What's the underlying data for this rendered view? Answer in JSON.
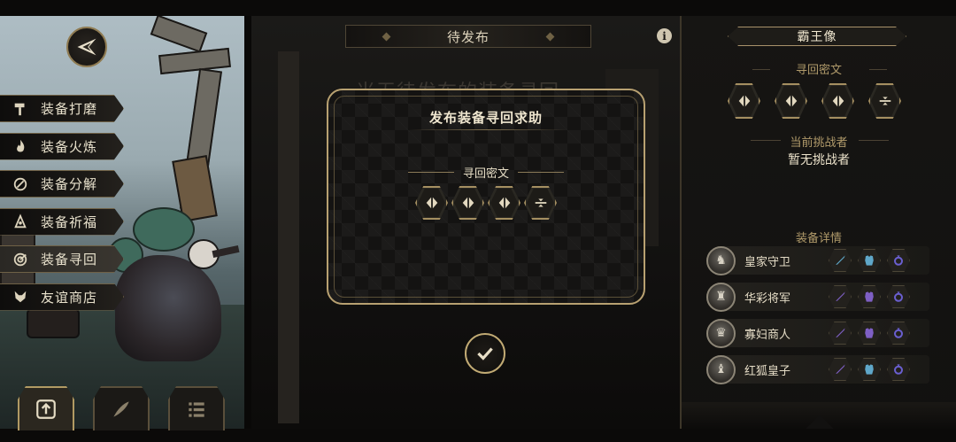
{
  "menu": {
    "items": [
      {
        "label": "装备打磨",
        "icon": "hammer-icon"
      },
      {
        "label": "装备火炼",
        "icon": "flame-icon"
      },
      {
        "label": "装备分解",
        "icon": "disassemble-icon"
      },
      {
        "label": "装备祈福",
        "icon": "blessing-icon"
      },
      {
        "label": "装备寻回",
        "icon": "retrieve-icon"
      },
      {
        "label": "友谊商店",
        "icon": "fox-shop-icon"
      }
    ],
    "active_index": 4
  },
  "bottom_tabs": [
    {
      "icon": "upload-arrow-icon",
      "active": true
    },
    {
      "icon": "feather-icon",
      "active": false
    },
    {
      "icon": "list-icon",
      "active": false
    }
  ],
  "center": {
    "pending_title": "待发布",
    "background_text": "当无待发布的装备寻回"
  },
  "dialog": {
    "title": "发布装备寻回求助",
    "rune_label": "寻回密文",
    "runes": [
      "split-diamond-rune-icon",
      "split-diamond-rune-icon",
      "split-diamond-rune-icon",
      "bar-rune-icon"
    ]
  },
  "statue": {
    "title": "霸王像",
    "rune_label": "寻回密文",
    "runes": [
      "split-diamond-rune-icon",
      "split-diamond-rune-icon",
      "split-diamond-rune-icon",
      "bar-rune-icon"
    ],
    "challenger_label": "当前挑战者",
    "challenger_value": "暂无挑战者",
    "equip_label": "装备详情",
    "equipment": [
      {
        "name": "皇家守卫",
        "avatar": "guard-avatar",
        "slots": [
          "sword-icon",
          "armor-icon",
          "ring-icon"
        ]
      },
      {
        "name": "华彩将军",
        "avatar": "general-avatar",
        "slots": [
          "sword-icon",
          "armor-icon",
          "ring-icon"
        ]
      },
      {
        "name": "寡妇商人",
        "avatar": "widow-avatar",
        "slots": [
          "sword-icon",
          "armor-icon",
          "ring-icon"
        ]
      },
      {
        "name": "红狐皇子",
        "avatar": "fox-prince-avatar",
        "slots": [
          "sword-icon",
          "armor-icon",
          "ring-icon"
        ]
      }
    ]
  },
  "colors": {
    "gold": "#b8a171",
    "sword": "#7e5fc4",
    "armor_blue": "#5fa7c9",
    "ring": "#6a5fd0"
  }
}
